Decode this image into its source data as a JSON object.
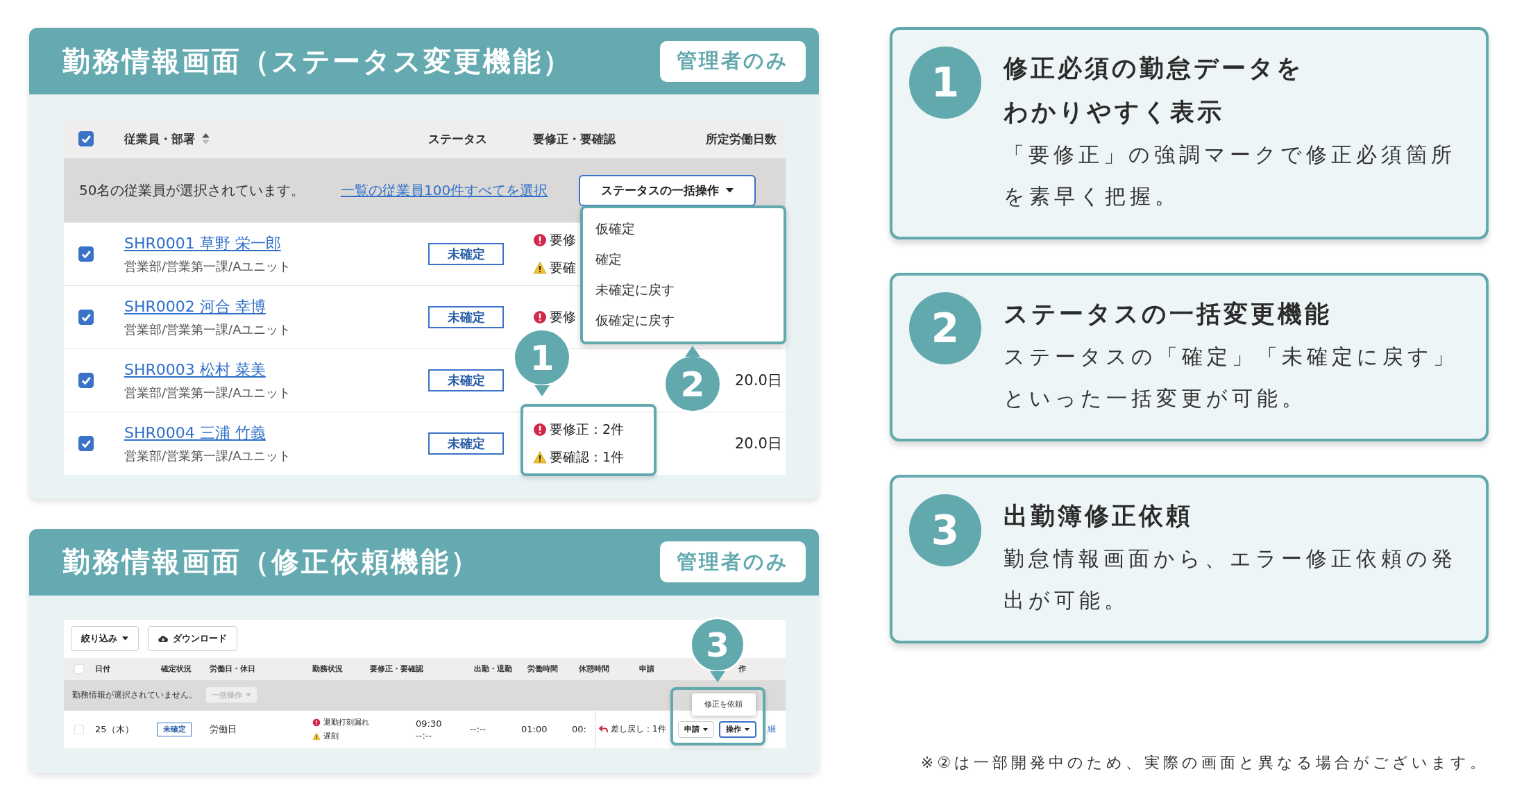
{
  "status_panel": {
    "title": "勤務情報画面（ステータス変更機能）",
    "badge": "管理者のみ",
    "table": {
      "select_all": {
        "checked": true
      },
      "columns": [
        "従業員・部署",
        "ステータス",
        "要修正・要確認",
        "所定労働日数"
      ],
      "selection_bar": {
        "text": "50名の従業員が選択されています。",
        "link": "一覧の従業員100件すべてを選択",
        "bulk_button": "ステータスの一括操作"
      },
      "rows": [
        {
          "checked": true,
          "name": "SHR0001 草野 栄一郎",
          "department": "営業部/営業第一課/Aユニット",
          "status": "未確定",
          "flags": [
            {
              "kind": "error",
              "text": "要修"
            },
            {
              "kind": "warning",
              "text": "要確"
            }
          ]
        },
        {
          "checked": true,
          "name": "SHR0002 河合 幸博",
          "department": "営業部/営業第一課/Aユニット",
          "status": "未確定",
          "flags": [
            {
              "kind": "error",
              "text": "要修"
            }
          ]
        },
        {
          "checked": true,
          "name": "SHR0003 松村 菜美",
          "department": "営業部/営業第一課/Aユニット",
          "status": "未確定",
          "days": "20.0日"
        },
        {
          "checked": true,
          "name": "SHR0004 三浦 竹義",
          "department": "営業部/営業第一課/Aユニット",
          "status": "未確定",
          "flags": [
            {
              "kind": "error",
              "text": "要修正：2件"
            },
            {
              "kind": "warning",
              "text": "要確認：1件"
            }
          ],
          "days": "20.0日"
        }
      ]
    },
    "bulk_menu": {
      "items": [
        "仮確定",
        "確定",
        "未確定に戻す",
        "仮確定に戻す"
      ]
    },
    "callouts": [
      "1",
      "2"
    ]
  },
  "request_panel": {
    "title": "勤務情報画面（修正依頼機能）",
    "badge": "管理者のみ",
    "toolbar": [
      {
        "kind": "filter",
        "label": "絞り込み"
      },
      {
        "kind": "download",
        "label": "ダウンロード"
      }
    ],
    "select_all": {
      "checked": false
    },
    "columns": [
      "日付",
      "確定状況",
      "労働日・休日",
      "勤務状況",
      "要修正・要確認",
      "出勤・退勤",
      "労働時間",
      "休憩時間",
      "申請",
      "作"
    ],
    "selection_bar": {
      "text": "勤務情報が選択されていません。",
      "bulk_button": {
        "label": "一括操作",
        "disabled": true
      }
    },
    "rows": [
      {
        "checked": false,
        "date": "25（木）",
        "status": "未確定",
        "day_type": "労働日",
        "flags": [
          {
            "kind": "error",
            "text": "退勤打刻漏れ"
          },
          {
            "kind": "warning",
            "text": "遅刻"
          }
        ],
        "clock": [
          "09:30",
          "--:--"
        ],
        "column_7": "--:--",
        "work_time": "01:00",
        "break_time": "00:",
        "request": "差し戻し：1件",
        "apply_button": "申請",
        "action_button": "操作",
        "column_12": "細"
      }
    ],
    "popup_menu": {
      "items": [
        "修正を依頼"
      ]
    },
    "callout": "3"
  },
  "features": [
    {
      "number": "1",
      "title": [
        "修正必須の勤怠データを",
        "わかりやすく表示"
      ],
      "body": "「要修正」の強調マークで修正必須箇所を素早く把握。"
    },
    {
      "number": "2",
      "title": [
        "ステータスの一括変更機能"
      ],
      "body": "ステータスの「確定」「未確定に戻す」といった一括変更が可能。"
    },
    {
      "number": "3",
      "title": [
        "出勤簿修正依頼"
      ],
      "body": "勤怠情報画面から、エラー修正依頼の発出が可能。"
    }
  ],
  "footnote": "※②は一部開発中のため、実際の画面と異なる場合がございます。"
}
